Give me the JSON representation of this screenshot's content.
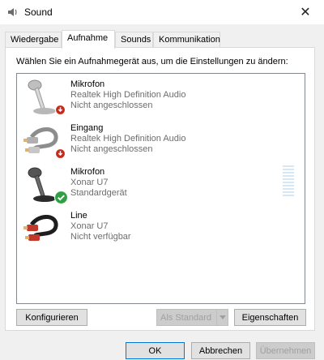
{
  "window": {
    "title": "Sound",
    "close_label": "✕"
  },
  "tabs": [
    {
      "label": "Wiedergabe"
    },
    {
      "label": "Aufnahme"
    },
    {
      "label": "Sounds"
    },
    {
      "label": "Kommunikation"
    }
  ],
  "panel": {
    "instruction": "Wählen Sie ein Aufnahmegerät aus, um die Einstellungen zu ändern:"
  },
  "devices": [
    {
      "name": "Mikrofon",
      "driver": "Realtek High Definition Audio",
      "status": "Nicht angeschlossen",
      "icon": "microphone-icon",
      "badge": "disconnected-icon"
    },
    {
      "name": "Eingang",
      "driver": "Realtek High Definition Audio",
      "status": "Nicht angeschlossen",
      "icon": "cable-icon",
      "badge": "disconnected-icon"
    },
    {
      "name": "Mikrofon",
      "driver": "Xonar U7",
      "status": "Standardgerät",
      "icon": "microphone-icon",
      "badge": "default-check-icon"
    },
    {
      "name": "Line",
      "driver": "Xonar U7",
      "status": "Nicht verfügbar",
      "icon": "cable-icon",
      "badge": ""
    }
  ],
  "buttons": {
    "configure": "Konfigurieren",
    "set_default": "Als Standard",
    "properties": "Eigenschaften",
    "ok": "OK",
    "cancel": "Abbrechen",
    "apply": "Übernehmen"
  },
  "colors": {
    "accent": "#0078d7",
    "default_check": "#2ea043",
    "disconnected": "#c42b1c",
    "cable_red": "#c0392b"
  }
}
